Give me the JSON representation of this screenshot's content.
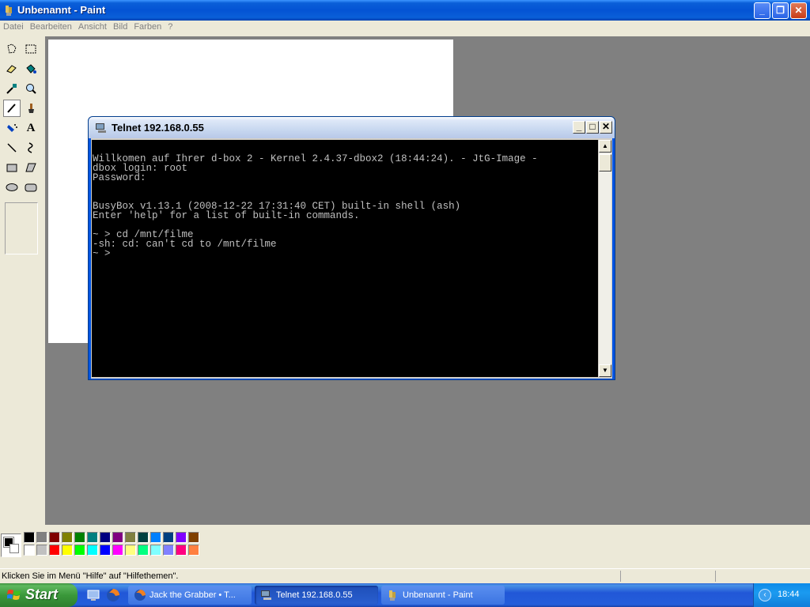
{
  "paint": {
    "title": "Unbenannt - Paint",
    "menu": [
      "Datei",
      "Bearbeiten",
      "Ansicht",
      "Bild",
      "Farben",
      "?"
    ],
    "status_text": "Klicken Sie im Menü \"Hilfe\" auf \"Hilfethemen\".",
    "palette_top": [
      "#000000",
      "#808080",
      "#800000",
      "#808000",
      "#008000",
      "#008080",
      "#000080",
      "#800080",
      "#808040",
      "#004040",
      "#0080ff",
      "#004080",
      "#8000ff",
      "#804000"
    ],
    "palette_bottom": [
      "#ffffff",
      "#c0c0c0",
      "#ff0000",
      "#ffff00",
      "#00ff00",
      "#00ffff",
      "#0000ff",
      "#ff00ff",
      "#ffff80",
      "#00ff80",
      "#80ffff",
      "#8080ff",
      "#ff0080",
      "#ff8040"
    ]
  },
  "telnet": {
    "title": "Telnet 192.168.0.55",
    "console_lines": [
      "",
      "Willkomen auf Ihrer d-box 2 - Kernel 2.4.37-dbox2 (18:44:24). - JtG-Image -",
      "dbox login: root",
      "Password:",
      "",
      "",
      "BusyBox v1.13.1 (2008-12-22 17:31:40 CET) built-in shell (ash)",
      "Enter 'help' for a list of built-in commands.",
      "",
      "~ > cd /mnt/filme",
      "-sh: cd: can't cd to /mnt/filme",
      "~ > "
    ]
  },
  "taskbar": {
    "start_label": "Start",
    "tasks": [
      {
        "label": "Jack the Grabber • T...",
        "icon": "firefox-icon"
      },
      {
        "label": "Telnet 192.168.0.55",
        "icon": "telnet-icon"
      },
      {
        "label": "Unbenannt - Paint",
        "icon": "paint-icon"
      }
    ],
    "clock": "18:44"
  }
}
